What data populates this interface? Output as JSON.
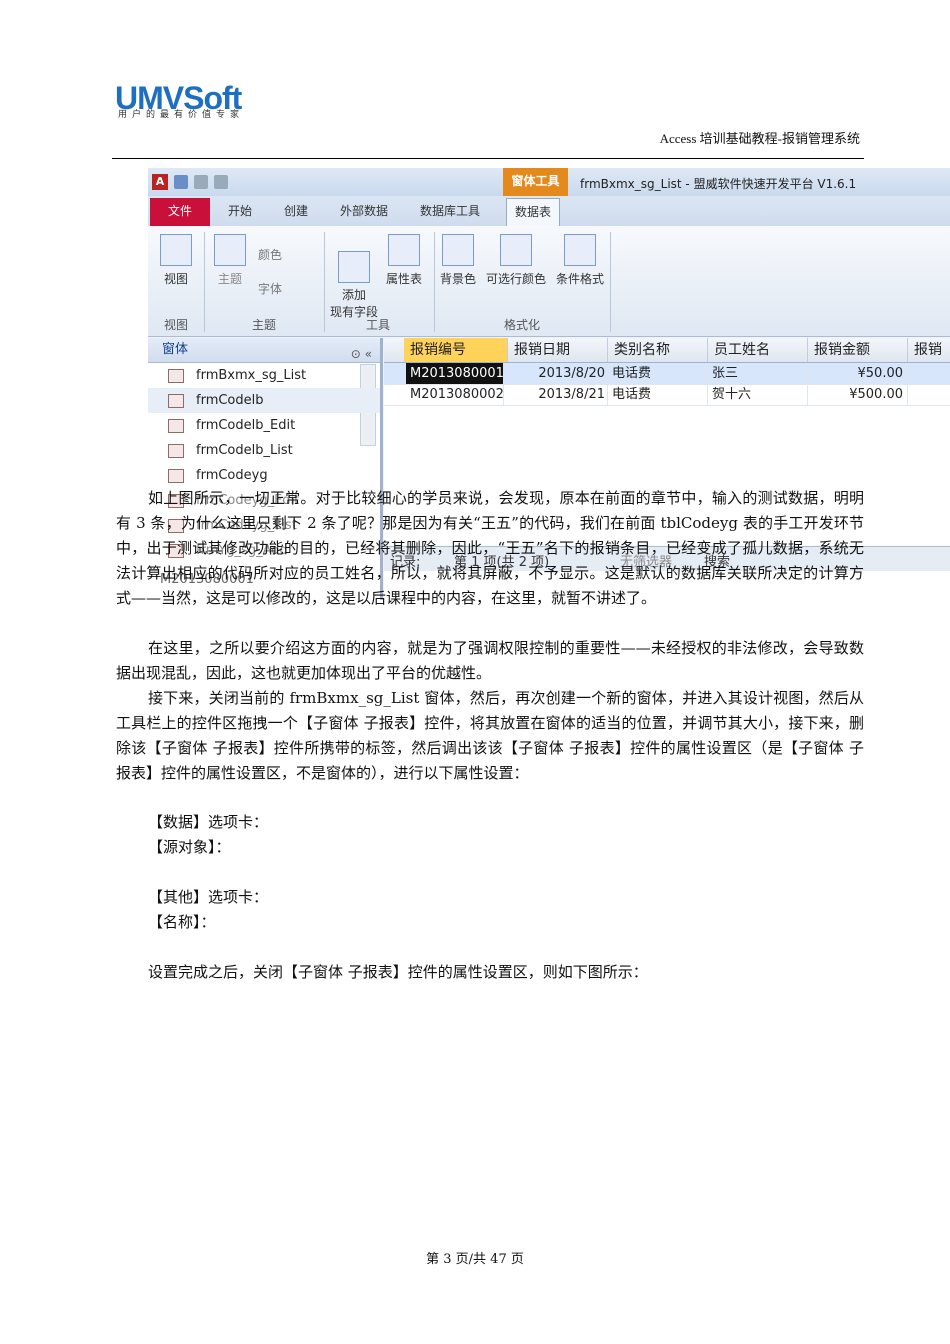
{
  "header": {
    "logo_main": "UMV",
    "logo_soft": "Soft",
    "logo_tagline": "用户的最有价值专家",
    "doc_title": "Access 培训基础教程-报销管理系统"
  },
  "screenshot": {
    "context_tab": "窗体工具",
    "window_title": "frmBxmx_sg_List - 盟威软件快速开发平台 V1.6.1",
    "tabs": [
      "文件",
      "开始",
      "创建",
      "外部数据",
      "数据库工具",
      "数据表"
    ],
    "ribbon": {
      "view": "视图",
      "theme": "主题",
      "colors": "颜色",
      "fonts": "字体",
      "add_fields": "添加\n现有字段",
      "property_sheet": "属性表",
      "background": "背景色",
      "alt_row_color": "可选行颜色",
      "conditional_format": "条件格式",
      "group_view": "视图",
      "group_theme": "主题",
      "group_tools": "工具",
      "group_format": "格式化"
    },
    "nav": {
      "header": "窗体",
      "items": [
        "frmBxmx_sg_List",
        "frmCodelb",
        "frmCodelb_Edit",
        "frmCodelb_List",
        "frmCodeyg",
        "frmCodeyg_Edit",
        "frmCodeyg_List",
        "frmYg_sg_Add"
      ]
    },
    "grid": {
      "columns": [
        "报销编号",
        "报销日期",
        "类别名称",
        "员工姓名",
        "报销金额",
        "报销"
      ],
      "rows": [
        [
          "M2013080001",
          "2013/8/20",
          "电话费",
          "张三",
          "¥50.00"
        ],
        [
          "M2013080002",
          "2013/8/21",
          "电话费",
          "贺十六",
          "¥500.00"
        ]
      ],
      "overlay_text": "M2013080001"
    },
    "status": {
      "record": "记录:",
      "position": "第 1 项(共 2 项)",
      "filter": "无筛选器",
      "search": "搜索"
    }
  },
  "body": {
    "p1": "如上图所示，一切正常。对于比较细心的学员来说，会发现，原本在前面的章节中，输入的测试数据，明明有 3 条，为什么这里只剩下 2 条了呢？那是因为有关“王五”的代码，我们在前面 tblCodeyg 表的手工开发环节中，出于测试其修改功能的目的，已经将其删除，因此，“王五”名下的报销条目，已经变成了孤儿数据，系统无法计算出相应的代码所对应的员工姓名，所以，就将其屏蔽，不予显示。这是默认的数据库关联所决定的计算方式——当然，这是可以修改的，这是以后课程中的内容，在这里，就暂不讲述了。",
    "p2": "在这里，之所以要介绍这方面的内容，就是为了强调权限控制的重要性——未经授权的非法修改，会导致数据出现混乱，因此，这也就更加体现出了平台的优越性。",
    "p3": "接下来，关闭当前的 frmBxmx_sg_List 窗体，然后，再次创建一个新的窗体，并进入其设计视图，然后从工具栏上的控件区拖拽一个【子窗体 子报表】控件，将其放置在窗体的适当的位置，并调节其大小，接下来，删除该【子窗体 子报表】控件所携带的标签，然后调出该该【子窗体 子报表】控件的属性设置区（是【子窗体 子报表】控件的属性设置区，不是窗体的），进行以下属性设置：",
    "data_tab": "【数据】选项卡：",
    "source_obj": "【源对象】：",
    "other_tab": "【其他】选项卡：",
    "name_prop": "【名称】：",
    "p4": "设置完成之后，关闭【子窗体 子报表】控件的属性设置区，则如下图所示："
  },
  "footer": {
    "page": "第 3 页/共 47 页"
  }
}
